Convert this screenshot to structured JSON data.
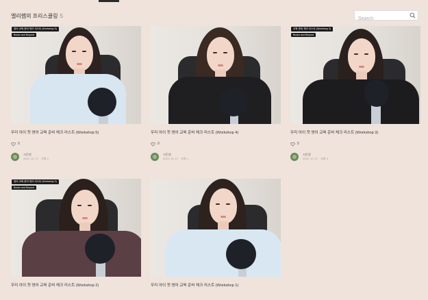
{
  "header": {
    "title": "엘리쌤의 프리스쿨링",
    "count": "5",
    "search_placeholder": "Search"
  },
  "cards": [
    {
      "overlay_line1": "영어 교육 준비 체크 리스트 (Workshop 5)",
      "overlay_line2": "Books and Beyond",
      "title": "우리 아이 첫 영어 교육 준비 체크 리스트 (Workshop 5)",
      "likes": "0",
      "author": "서준쌤",
      "date": "2024. 10. 17",
      "views": "조회 2"
    },
    {
      "title": "우리 아이 첫 영어 교육 준비 체크 리스트 (Workshop 4)",
      "likes": "0",
      "author": "서준쌤",
      "date": "2024. 10. 17",
      "views": "조회 1"
    },
    {
      "overlay_line1": "교육 준비 체크 리스트 (Workshop 3)",
      "overlay_line2": "Books and Beyond",
      "title": "우리 아이 첫 영어 교육 준비 체크 리스트 (Workshop 3)",
      "likes": "0",
      "author": "서준쌤",
      "date": "2024. 10. 17",
      "views": "조회 3"
    },
    {
      "overlay_line1": "영어 교육 준비 체크 리스트 (Workshop 2)",
      "overlay_line2": "Books and Beyond",
      "title": "우리 아이 첫 영어 교육 준비 체크 리스트 (Workshop 2)"
    },
    {
      "title": "우리 아이 첫 영어 교육 준비 체크 리스트 (Workshop 1)"
    }
  ],
  "colors": {
    "page_background": "#efe3dc",
    "avatar_green": "#6b8a5a"
  },
  "icons": {
    "search": "search-icon",
    "like": "heart-icon"
  }
}
